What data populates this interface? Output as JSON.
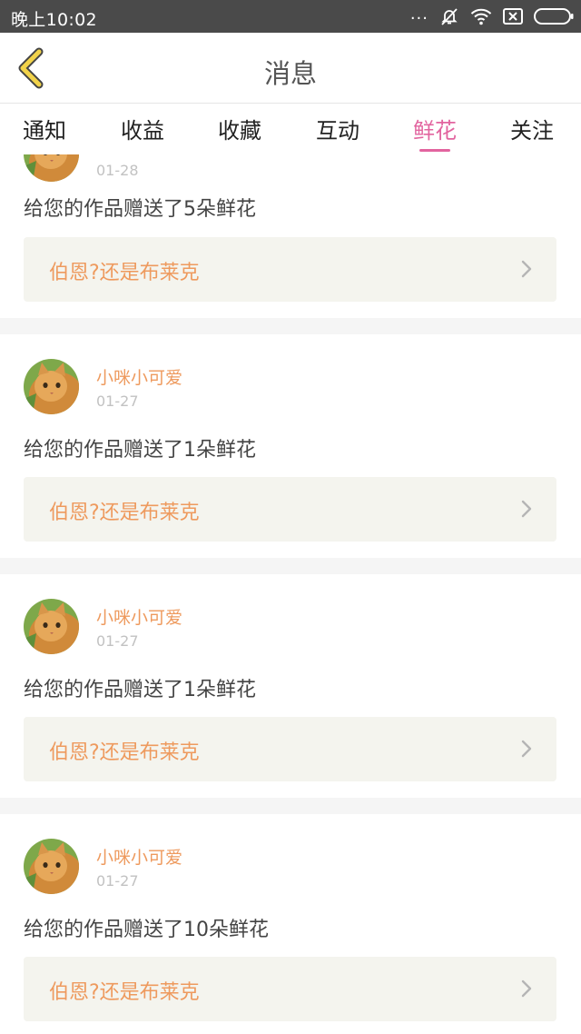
{
  "status_bar": {
    "time": "晚上10:02",
    "dots": "...",
    "icons": [
      "mute-bell-icon",
      "wifi-icon",
      "sim-off-icon",
      "battery-icon"
    ]
  },
  "header": {
    "title": "消息",
    "back_icon": "chevron-left-icon",
    "accent_color": "#f2d34a"
  },
  "tabs": [
    {
      "label": "通知",
      "active": false
    },
    {
      "label": "收益",
      "active": false
    },
    {
      "label": "收藏",
      "active": false
    },
    {
      "label": "互动",
      "active": false
    },
    {
      "label": "鲜花",
      "active": true
    },
    {
      "label": "关注",
      "active": false
    }
  ],
  "colors": {
    "active_tab": "#e2649f",
    "username": "#ee9a5e",
    "work_title": "#ee9a5e",
    "work_box_bg": "#f4f4ee",
    "separator": "#f5f5f5"
  },
  "messages": [
    {
      "user": "",
      "date": "01-28",
      "text": "给您的作品赠送了5朵鲜花",
      "work_title": "伯恩?还是布莱克"
    },
    {
      "user": "小咪小可爱",
      "date": "01-27",
      "text": "给您的作品赠送了1朵鲜花",
      "work_title": "伯恩?还是布莱克"
    },
    {
      "user": "小咪小可爱",
      "date": "01-27",
      "text": "给您的作品赠送了1朵鲜花",
      "work_title": "伯恩?还是布莱克"
    },
    {
      "user": "小咪小可爱",
      "date": "01-27",
      "text": "给您的作品赠送了10朵鲜花",
      "work_title": "伯恩?还是布莱克"
    }
  ]
}
